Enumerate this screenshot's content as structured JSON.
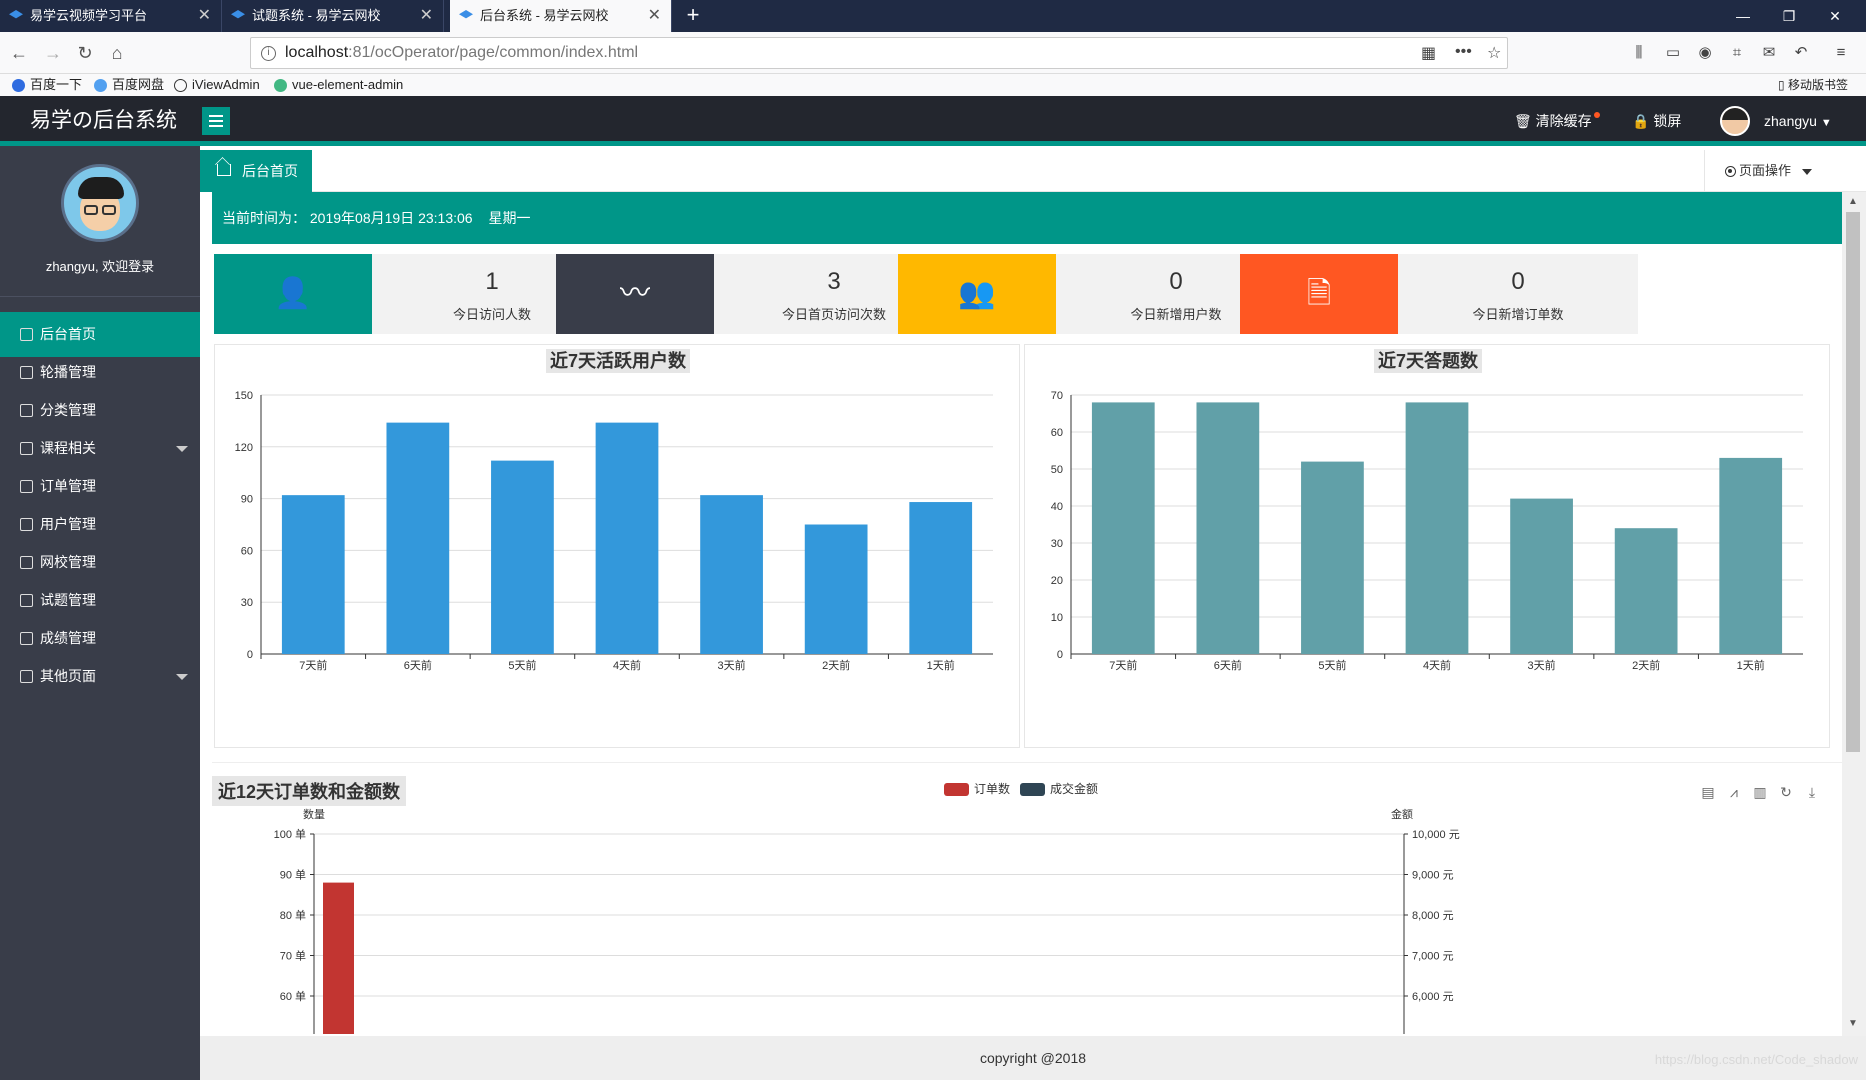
{
  "browser": {
    "tabs": [
      {
        "title": "易学云视频学习平台",
        "active": false
      },
      {
        "title": "试题系统 - 易学云网校",
        "active": false
      },
      {
        "title": "后台系统 - 易学云网校",
        "active": true
      }
    ],
    "url_host": "localhost",
    "url_rest": ":81/ocOperator/page/common/index.html",
    "bookmarks": [
      "百度一下",
      "百度网盘",
      "iViewAdmin",
      "vue-element-admin"
    ],
    "mobile_bookmarks": "移动版书签"
  },
  "header": {
    "logo": "易学の后台系统",
    "clear_cache": "清除缓存",
    "lock_screen": "锁屏",
    "username": "zhangyu"
  },
  "sidebar": {
    "welcome": "zhangyu, 欢迎登录",
    "items": [
      {
        "label": "后台首页",
        "active": true
      },
      {
        "label": "轮播管理"
      },
      {
        "label": "分类管理"
      },
      {
        "label": "课程相关",
        "expandable": true
      },
      {
        "label": "订单管理"
      },
      {
        "label": "用户管理"
      },
      {
        "label": "网校管理"
      },
      {
        "label": "试题管理"
      },
      {
        "label": "成绩管理"
      },
      {
        "label": "其他页面",
        "expandable": true
      }
    ]
  },
  "tabs": {
    "home": "后台首页",
    "page_ops": "页面操作"
  },
  "time": {
    "label": "当前时间为：",
    "datetime": "2019年08月19日 23:13:06",
    "weekday": "星期一"
  },
  "stats": [
    {
      "value": "1",
      "label": "今日访问人数",
      "color": "#009688",
      "icon": "user-icon"
    },
    {
      "value": "3",
      "label": "今日首页访问次数",
      "color": "#393d49",
      "icon": "pulse-icon"
    },
    {
      "value": "0",
      "label": "今日新增用户数",
      "color": "#ffb800",
      "icon": "group-icon"
    },
    {
      "value": "0",
      "label": "今日新增订单数",
      "color": "#ff5722",
      "icon": "document-icon"
    }
  ],
  "chart_data": [
    {
      "type": "bar",
      "title": "近7天活跃用户数",
      "categories": [
        "7天前",
        "6天前",
        "5天前",
        "4天前",
        "3天前",
        "2天前",
        "1天前"
      ],
      "values": [
        92,
        134,
        112,
        134,
        92,
        75,
        88
      ],
      "ylim": [
        0,
        150
      ],
      "yticks": [
        0,
        30,
        60,
        90,
        120,
        150
      ],
      "color": "#3398db",
      "grid": true
    },
    {
      "type": "bar",
      "title": "近7天答题数",
      "categories": [
        "7天前",
        "6天前",
        "5天前",
        "4天前",
        "3天前",
        "2天前",
        "1天前"
      ],
      "values": [
        68,
        68,
        52,
        68,
        42,
        34,
        53
      ],
      "ylim": [
        0,
        70
      ],
      "yticks": [
        0,
        10,
        20,
        30,
        40,
        50,
        60,
        70
      ],
      "color": "#61a0a8",
      "grid": true
    },
    {
      "type": "bar",
      "title": "近12天订单数和金额数",
      "series": [
        {
          "name": "订单数",
          "color": "#c23531",
          "first_value": 88
        },
        {
          "name": "成交金额",
          "color": "#2f4554"
        }
      ],
      "ylabel_left": "数量",
      "ylabel_right": "金额",
      "left_ticks": [
        "100 单",
        "90 单",
        "80 单",
        "70 单",
        "60 单"
      ],
      "right_ticks": [
        "10,000 元",
        "9,000 元",
        "8,000 元",
        "7,000 元",
        "6,000 元"
      ],
      "left_visible_range": [
        60,
        100
      ]
    }
  ],
  "footer": "copyright @2018",
  "watermark": "https://blog.csdn.net/Code_shadow"
}
